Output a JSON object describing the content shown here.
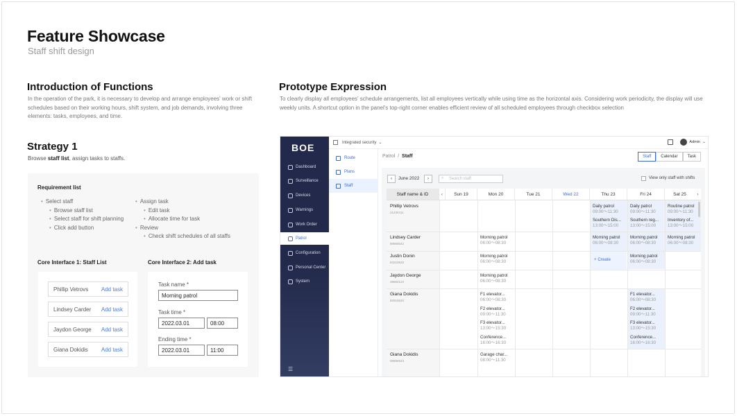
{
  "header": {
    "title": "Feature Showcase",
    "subtitle": "Staff shift design"
  },
  "intro": {
    "title": "Introduction of Functions",
    "text": "In the operation of the park, it is necessary to develop and arrange employees' work or shift schedules based on their working hours, shift system, and job demands, involving three elements: tasks, employees, and time."
  },
  "prototype": {
    "title": "Prototype Expression",
    "text": "To clearly display all employees' schedule arrangements, list all employees vertically while using time as the horizontal axis. Considering work periodicity, the display will use weekly units. A shortcut option in the panel's top-right corner enables efficient review of all scheduled employees through checkbox selection"
  },
  "strategy": {
    "title": "Strategy 1",
    "desc_prefix": "Browse ",
    "desc_bold": "staff list",
    "desc_suffix": ", assign tasks to staffs."
  },
  "requirements": {
    "title": "Requirement list",
    "left": [
      {
        "text": "Select staff",
        "level": 1
      },
      {
        "text": "Browse staff list",
        "level": 2
      },
      {
        "text": "Select staff for shift planning",
        "level": 2
      },
      {
        "text": "Click add button",
        "level": 2
      }
    ],
    "right": [
      {
        "text": "Assign task",
        "level": 1
      },
      {
        "text": "Edit task",
        "level": 2
      },
      {
        "text": "Allocate time for task",
        "level": 2
      },
      {
        "text": "Review",
        "level": 1
      },
      {
        "text": "Check shift schedules of all staffs",
        "level": 2
      }
    ]
  },
  "core1": {
    "title": "Core Interface 1: Staff List",
    "rows": [
      {
        "name": "Phillip Vetrovs",
        "action": "Add task"
      },
      {
        "name": "Lindsey Carder",
        "action": "Add task"
      },
      {
        "name": "Jaydon George",
        "action": "Add task"
      },
      {
        "name": "Giana Dokidis",
        "action": "Add task"
      }
    ]
  },
  "core2": {
    "title": "Core Interface 2: Add task",
    "task_name_label": "Task name *",
    "task_name_value": "Morning patrol",
    "task_time_label": "Task time *",
    "task_time_date": "2022.03.01",
    "task_time_hour": "08:00",
    "end_time_label": "Ending time *",
    "end_time_date": "2022.03.01",
    "end_time_hour": "11:00"
  },
  "app": {
    "logo": "BOE",
    "topbar_label": "Integrated security",
    "user": "Admin",
    "nav": [
      "Dashboard",
      "Surveillance",
      "Devices",
      "Warnings",
      "Work Order",
      "Patrol",
      "Configuration",
      "Personal Center",
      "System"
    ],
    "active_nav": "Patrol",
    "subnav": [
      "Route",
      "Plans",
      "Staff"
    ],
    "active_subnav": "Staff",
    "breadcrumb_parent": "Patrol",
    "breadcrumb_sep": "/",
    "breadcrumb_current": "Staff",
    "views": [
      "Staff",
      "Calendar",
      "Task"
    ],
    "active_view": "Staff",
    "month": "June 2022",
    "search_placeholder": "Search staff",
    "filter_label": "View only staff with shifts",
    "prev_icon": "‹",
    "next_icon": "›",
    "columns": [
      "Staff name & ID",
      "Sun 19",
      "Mon 20",
      "Tue 21",
      "Wed 22",
      "Thu 23",
      "Fri 24",
      "Sat 25"
    ],
    "today_column": "Wed 22",
    "create_label": "+ Create",
    "staff": [
      {
        "name": "Phillip Vetrovs",
        "id": "21234411"
      },
      {
        "name": "Lindsey Carder",
        "id": "89965542"
      },
      {
        "name": "Justin Donin",
        "id": "84223632"
      },
      {
        "name": "Jaydon George",
        "id": "35664122"
      },
      {
        "name": "Giana Dokidis",
        "id": "82915620"
      },
      {
        "name": "Giana Dokidis",
        "id": "66594523"
      }
    ],
    "events": {
      "r0_thu_1": {
        "title": "Daily patrol",
        "time": "09:00～11:30"
      },
      "r0_thu_2": {
        "title": "Southern Dis...",
        "time": "13:00～15:00"
      },
      "r0_fri_1": {
        "title": "Daily patrol",
        "time": "09:00～11:30"
      },
      "r0_fri_2": {
        "title": "Southern reg...",
        "time": "13:00～15:00"
      },
      "r0_sat_1": {
        "title": "Routine patrol",
        "time": "09:00～11:30"
      },
      "r0_sat_2": {
        "title": "Inventory of...",
        "time": "13:00～15:00"
      },
      "r1_mon": {
        "title": "Morning patrol",
        "time": "06:00～08:30"
      },
      "r1_thu": {
        "title": "Morning patrol",
        "time": "06:00～08:30"
      },
      "r1_fri": {
        "title": "Morning patrol",
        "time": "06:00～08:30"
      },
      "r1_sat": {
        "title": "Morning patrol",
        "time": "06:00～08:30"
      },
      "r2_mon": {
        "title": "Morning patrol",
        "time": "06:00～08:30"
      },
      "r2_fri": {
        "title": "Morning patrol",
        "time": "06:00～08:30"
      },
      "r3_mon": {
        "title": "Morning patrol",
        "time": "06:00～08:30"
      },
      "r4_mon_1": {
        "title": "F1 elevator...",
        "time": "06:00～08:30"
      },
      "r4_mon_2": {
        "title": "F2 elevator...",
        "time": "09:00～11:30"
      },
      "r4_mon_3": {
        "title": "F3 elevator...",
        "time": "13:00～15:30"
      },
      "r4_mon_4": {
        "title": "Conference...",
        "time": "16:00～16:30"
      },
      "r4_fri_1": {
        "title": "F1 elevator...",
        "time": "06:00～08:30"
      },
      "r4_fri_2": {
        "title": "F2 elevator...",
        "time": "09:00～11:30"
      },
      "r4_fri_3": {
        "title": "F3 elevator...",
        "time": "13:00～15:30"
      },
      "r4_fri_4": {
        "title": "Conference...",
        "time": "16:00～16:30"
      },
      "r5_mon": {
        "title": "Garage char...",
        "time": "08:00～11:30"
      }
    }
  }
}
